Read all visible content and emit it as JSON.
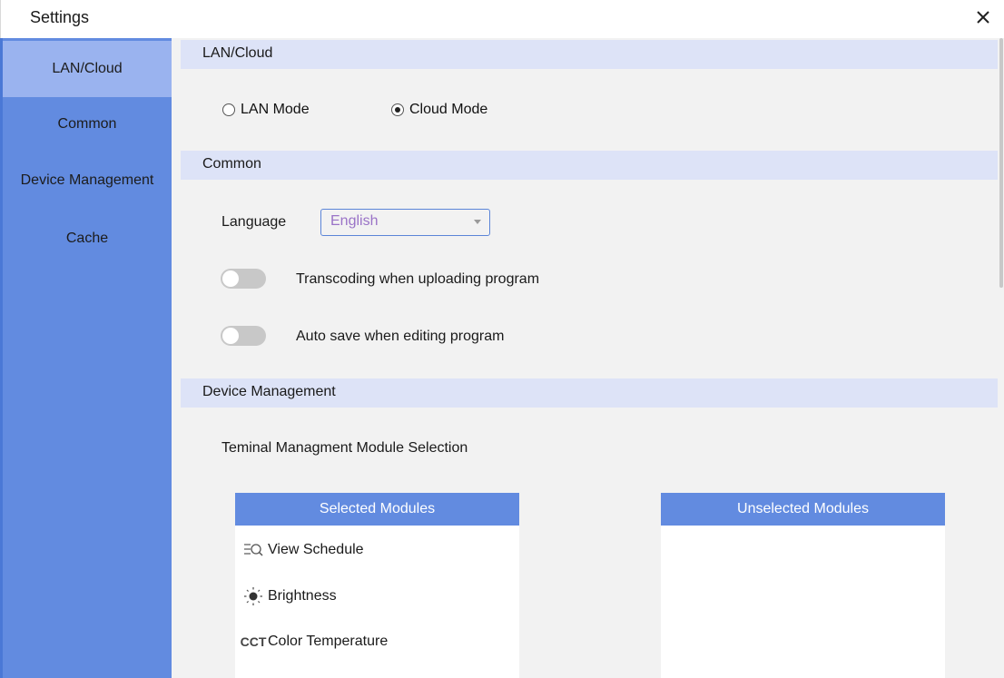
{
  "window": {
    "title": "Settings",
    "close_icon": "close-icon"
  },
  "sidebar": {
    "items": [
      {
        "label": "LAN/Cloud",
        "active": true
      },
      {
        "label": "Common",
        "active": false
      },
      {
        "label": "Device Management",
        "active": false
      },
      {
        "label": "Cache",
        "active": false
      }
    ]
  },
  "sections": {
    "lan_cloud": {
      "header": "LAN/Cloud",
      "lan_mode_label": "LAN Mode",
      "cloud_mode_label": "Cloud Mode",
      "selected_mode": "Cloud Mode"
    },
    "common": {
      "header": "Common",
      "language_label": "Language",
      "language_value": "English",
      "transcoding_label": "Transcoding when uploading program",
      "transcoding_enabled": false,
      "autosave_label": "Auto save when editing program",
      "autosave_enabled": false
    },
    "device_management": {
      "header": "Device Management",
      "module_selection_label": "Teminal Managment Module Selection",
      "selected_modules_header": "Selected Modules",
      "unselected_modules_header": "Unselected Modules",
      "selected_modules": [
        {
          "label": "View Schedule",
          "icon": "view-schedule-icon"
        },
        {
          "label": "Brightness",
          "icon": "brightness-icon"
        },
        {
          "label": "Color Temperature",
          "icon": "color-temperature-icon",
          "icon_text": "CCT"
        }
      ]
    }
  },
  "colors": {
    "sidebar": "#628be0",
    "sidebar_active": "#9ab3ef",
    "section_header": "#dde3f7",
    "content_bg": "#f2f2f2",
    "accent": "#5b85d8",
    "language_text": "#9a73c7"
  }
}
